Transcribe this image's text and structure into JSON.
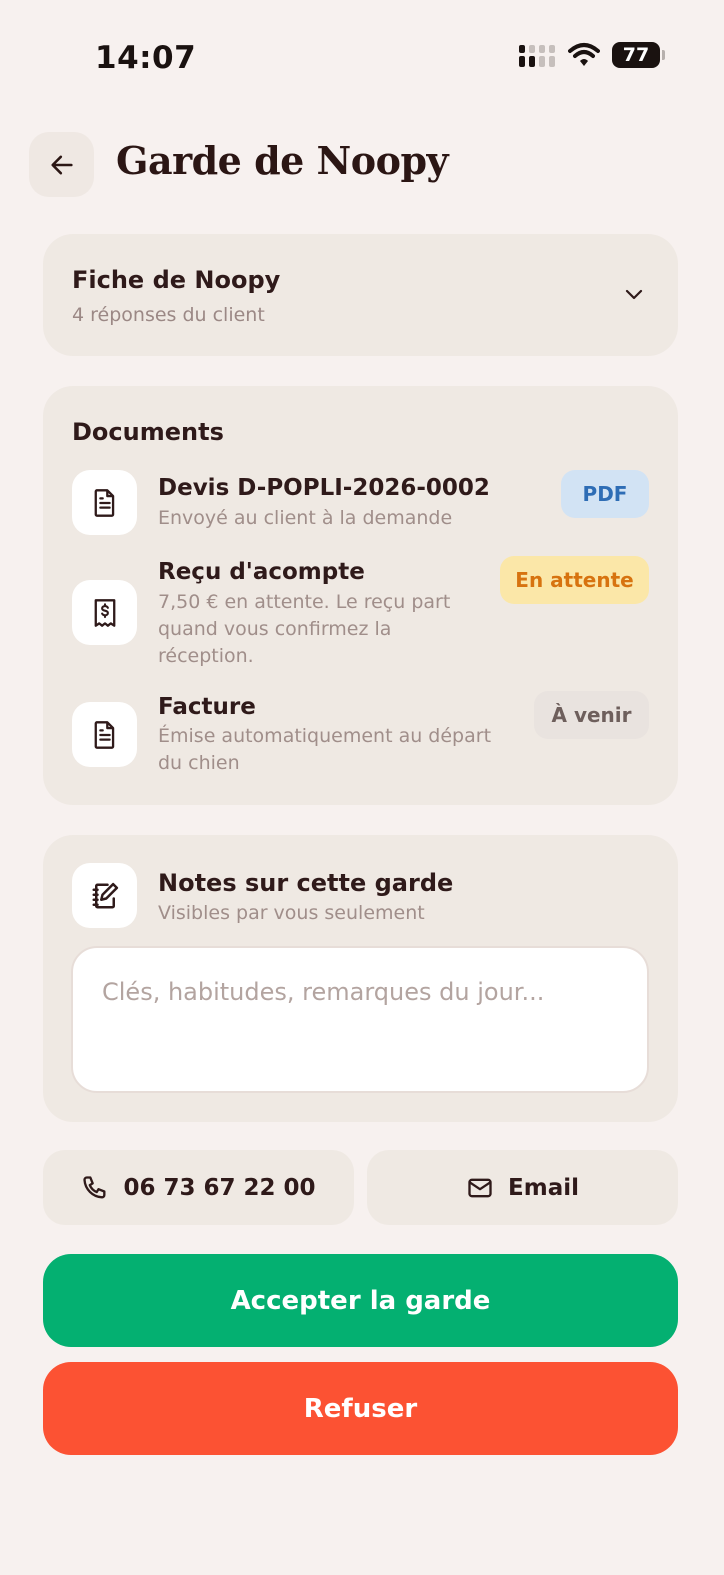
{
  "status_bar": {
    "time": "14:07",
    "battery": "77"
  },
  "header": {
    "title": "Garde de Noopy"
  },
  "fiche": {
    "title": "Fiche de Noopy",
    "subtitle": "4 réponses du client"
  },
  "documents": {
    "title": "Documents",
    "items": [
      {
        "title": "Devis D-POPLI-2026-0002",
        "subtitle": "Envoyé au client à la demande",
        "badge": "PDF"
      },
      {
        "title": "Reçu d'acompte",
        "subtitle_lines": [
          "7,50 € en attente. Le reçu part",
          "quand vous confirmez la",
          "réception."
        ],
        "badge": "En attente"
      },
      {
        "title": "Facture",
        "subtitle_lines": [
          "Émise automatiquement au départ",
          "du chien"
        ],
        "badge": "À venir"
      }
    ]
  },
  "notes": {
    "title": "Notes sur cette garde",
    "subtitle": "Visibles par vous seulement",
    "placeholder": "Clés, habitudes, remarques du jour..."
  },
  "contact": {
    "phone": "06 73 67 22 00",
    "email_label": "Email"
  },
  "actions": {
    "accept": "Accepter la garde",
    "refuse": "Refuser"
  },
  "colors": {
    "background": "#f7f1ef",
    "card": "#efe9e3",
    "accept": "#04b071",
    "refuse": "#fc5233",
    "badge_pdf": "#d2e3f4",
    "badge_wait": "#fbe7a8"
  }
}
